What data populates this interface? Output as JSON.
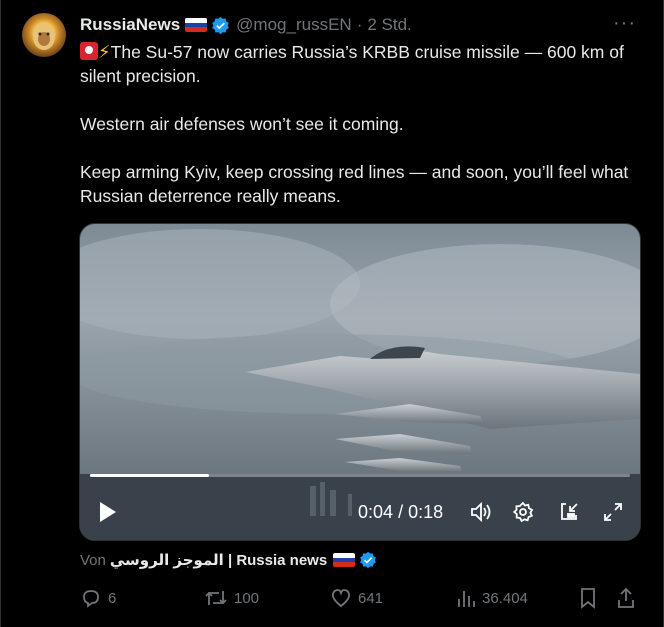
{
  "tweet": {
    "author_name": "RussiaNews",
    "handle": "@mog_russEN",
    "separator": "·",
    "time": "2 Std.",
    "more_label": "···",
    "text_line1": "The Su-57 now carries Russia’s KRBB cruise missile — 600 km of silent precision.",
    "text_line2": "Western air defenses won’t see it coming.",
    "text_line3": "Keep arming Kyiv, keep crossing red lines — and soon, you’ll feel what Russian deterrence really means."
  },
  "video": {
    "current_time": "0:04",
    "time_separator": "/",
    "duration": "0:18",
    "progress_fraction": 0.22
  },
  "attribution": {
    "prefix": "Von",
    "source": "الموجز الروسي | Russia news"
  },
  "actions": {
    "replies": "6",
    "reposts": "100",
    "likes": "641",
    "views": "36.404"
  },
  "colors": {
    "background": "#000000",
    "text": "#e7e9ea",
    "muted": "#71767b",
    "verified_blue": "#1d9bf0"
  },
  "icons": [
    "siren-emoji",
    "lightning-emoji",
    "verified-icon",
    "flag-russia-icon",
    "play-icon",
    "volume-icon",
    "settings-icon",
    "pip-icon",
    "fullscreen-icon",
    "reply-icon",
    "repost-icon",
    "like-icon",
    "views-icon",
    "bookmark-icon",
    "share-icon"
  ]
}
